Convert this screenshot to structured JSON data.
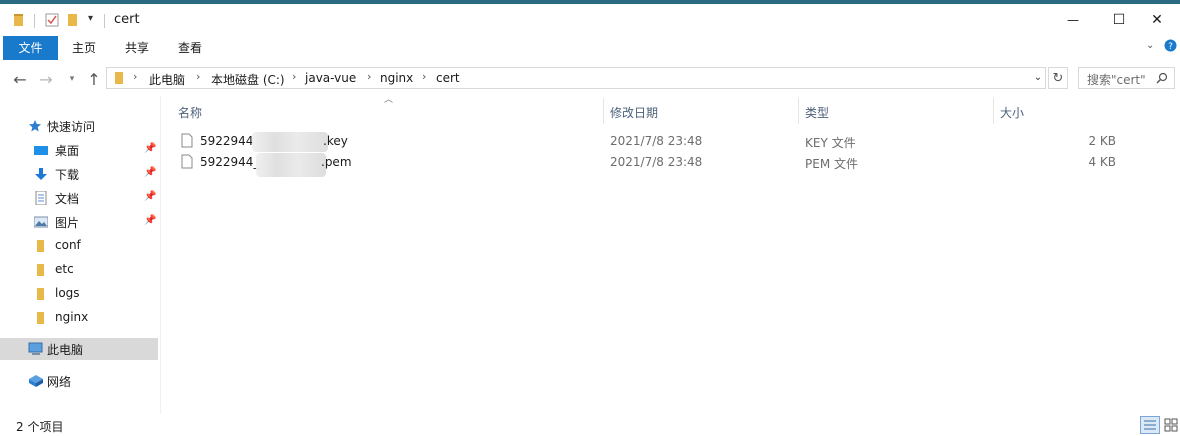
{
  "window": {
    "title": "cert",
    "controls": {
      "minimize": "—",
      "maximize": "☐",
      "close": "✕"
    }
  },
  "ribbon": {
    "tabs": [
      "文件",
      "主页",
      "共享",
      "查看"
    ],
    "help_icon": "?"
  },
  "address": {
    "breadcrumb": [
      "此电脑",
      "本地磁盘 (C:)",
      "java-vue",
      "nginx",
      "cert"
    ],
    "search_placeholder": "搜索\"cert\""
  },
  "nav_pane": {
    "quick_access": "快速访问",
    "pinned": [
      {
        "label": "桌面",
        "icon": "desktop-icon"
      },
      {
        "label": "下载",
        "icon": "download-icon"
      },
      {
        "label": "文档",
        "icon": "documents-icon"
      },
      {
        "label": "图片",
        "icon": "pictures-icon"
      }
    ],
    "folders": [
      "conf",
      "etc",
      "logs",
      "nginx"
    ],
    "this_pc": "此电脑",
    "network": "网络"
  },
  "file_list": {
    "columns": [
      "名称",
      "修改日期",
      "类型",
      "大小"
    ],
    "rows": [
      {
        "name_start": "5922944",
        "name_end": ".key",
        "modified": "2021/7/8 23:48",
        "type": "KEY 文件",
        "size": "2 KB"
      },
      {
        "name_start": "5922944_",
        "name_end": ".pem",
        "modified": "2021/7/8 23:48",
        "type": "PEM 文件",
        "size": "4 KB"
      }
    ]
  },
  "status_bar": {
    "item_count": "2 个项目"
  },
  "colors": {
    "file_tab": "#1979ca",
    "folder": "#e8b84a",
    "selected_nav": "#d9d9d9",
    "header_text": "#4c607a"
  }
}
